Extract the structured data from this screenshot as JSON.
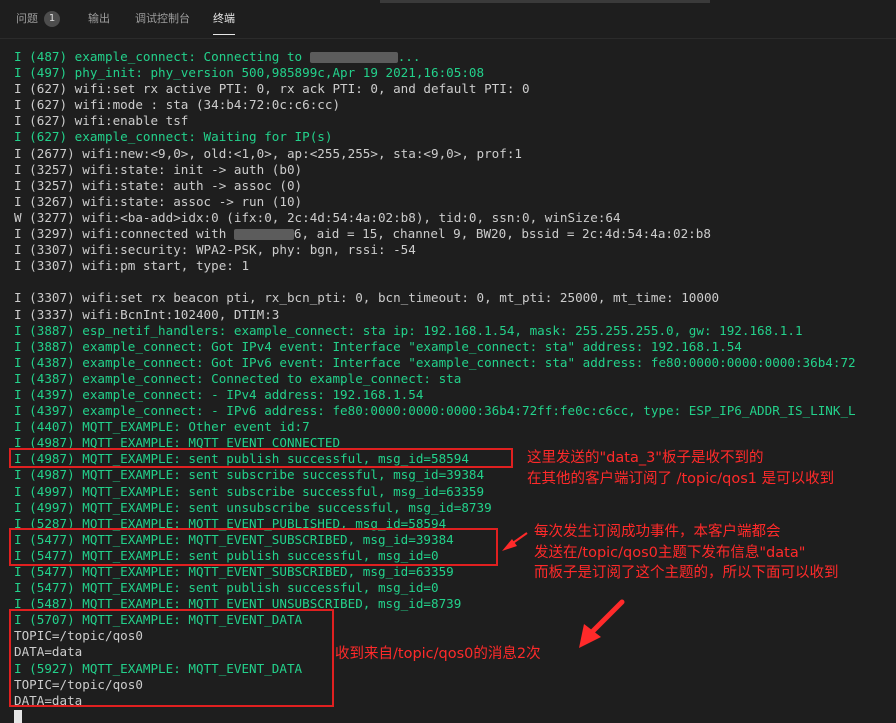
{
  "tabs": [
    {
      "label": "问题",
      "badge": "1"
    },
    {
      "label": "输出"
    },
    {
      "label": "调试控制台"
    },
    {
      "label": "终端",
      "active": true
    }
  ],
  "colors": {
    "info_green": "#23d18b",
    "default_text": "#cccccc",
    "annotation_red": "#ff2a2a",
    "background": "#1e1e1e"
  },
  "terminal": {
    "lines": [
      {
        "text": "I (487) example_connect: Connecting to ",
        "tail": "...",
        "color": "green",
        "redacted": true
      },
      {
        "text": "I (497) phy_init: phy_version 500,985899c,Apr 19 2021,16:05:08",
        "color": "green"
      },
      {
        "text": "I (627) wifi:set rx active PTI: 0, rx ack PTI: 0, and default PTI: 0",
        "color": "default"
      },
      {
        "text": "I (627) wifi:mode : sta (34:b4:72:0c:c6:cc)",
        "color": "default"
      },
      {
        "text": "I (627) wifi:enable tsf",
        "color": "default"
      },
      {
        "text": "I (627) example_connect: Waiting for IP(s)",
        "color": "green"
      },
      {
        "text": "I (2677) wifi:new:<9,0>, old:<1,0>, ap:<255,255>, sta:<9,0>, prof:1",
        "color": "default"
      },
      {
        "text": "I (3257) wifi:state: init -> auth (b0)",
        "color": "default"
      },
      {
        "text": "I (3257) wifi:state: auth -> assoc (0)",
        "color": "default"
      },
      {
        "text": "I (3267) wifi:state: assoc -> run (10)",
        "color": "default"
      },
      {
        "text": "W (3277) wifi:<ba-add>idx:0 (ifx:0, 2c:4d:54:4a:02:b8), tid:0, ssn:0, winSize:64",
        "color": "default"
      },
      {
        "text": "I (3297) wifi:connected with ",
        "tail": "6, aid = 15, channel 9, BW20, bssid = 2c:4d:54:4a:02:b8",
        "color": "default",
        "redacted": true
      },
      {
        "text": "I (3307) wifi:security: WPA2-PSK, phy: bgn, rssi: -54",
        "color": "default"
      },
      {
        "text": "I (3307) wifi:pm start, type: 1",
        "color": "default"
      },
      {
        "text": "",
        "color": "default"
      },
      {
        "text": "I (3307) wifi:set rx beacon pti, rx_bcn_pti: 0, bcn_timeout: 0, mt_pti: 25000, mt_time: 10000",
        "color": "default"
      },
      {
        "text": "I (3337) wifi:BcnInt:102400, DTIM:3",
        "color": "default"
      },
      {
        "text": "I (3887) esp_netif_handlers: example_connect: sta ip: 192.168.1.54, mask: 255.255.255.0, gw: 192.168.1.1",
        "color": "green"
      },
      {
        "text": "I (3887) example_connect: Got IPv4 event: Interface \"example_connect: sta\" address: 192.168.1.54",
        "color": "green"
      },
      {
        "text": "I (4387) example_connect: Got IPv6 event: Interface \"example_connect: sta\" address: fe80:0000:0000:0000:36b4:72",
        "color": "green"
      },
      {
        "text": "I (4387) example_connect: Connected to example_connect: sta",
        "color": "green"
      },
      {
        "text": "I (4397) example_connect: - IPv4 address: 192.168.1.54",
        "color": "green"
      },
      {
        "text": "I (4397) example_connect: - IPv6 address: fe80:0000:0000:0000:36b4:72ff:fe0c:c6cc, type: ESP_IP6_ADDR_IS_LINK_L",
        "color": "green"
      },
      {
        "text": "I (4407) MQTT_EXAMPLE: Other event id:7",
        "color": "green"
      },
      {
        "text": "I (4987) MQTT_EXAMPLE: MQTT_EVENT_CONNECTED",
        "color": "green"
      },
      {
        "text": "I (4987) MQTT_EXAMPLE: sent publish successful, msg_id=58594",
        "color": "green"
      },
      {
        "text": "I (4987) MQTT_EXAMPLE: sent subscribe successful, msg_id=39384",
        "color": "green"
      },
      {
        "text": "I (4997) MQTT_EXAMPLE: sent subscribe successful, msg_id=63359",
        "color": "green"
      },
      {
        "text": "I (4997) MQTT_EXAMPLE: sent unsubscribe successful, msg_id=8739",
        "color": "green"
      },
      {
        "text": "I (5287) MQTT_EXAMPLE: MQTT_EVENT_PUBLISHED, msg_id=58594",
        "color": "green"
      },
      {
        "text": "I (5477) MQTT_EXAMPLE: MQTT_EVENT_SUBSCRIBED, msg_id=39384",
        "color": "green"
      },
      {
        "text": "I (5477) MQTT_EXAMPLE: sent publish successful, msg_id=0",
        "color": "green"
      },
      {
        "text": "I (5477) MQTT_EXAMPLE: MQTT_EVENT_SUBSCRIBED, msg_id=63359",
        "color": "green"
      },
      {
        "text": "I (5477) MQTT_EXAMPLE: sent publish successful, msg_id=0",
        "color": "green"
      },
      {
        "text": "I (5487) MQTT_EXAMPLE: MQTT_EVENT_UNSUBSCRIBED, msg_id=8739",
        "color": "green"
      },
      {
        "text": "I (5707) MQTT_EXAMPLE: MQTT_EVENT_DATA",
        "color": "green"
      },
      {
        "text": "TOPIC=/topic/qos0",
        "color": "default"
      },
      {
        "text": "DATA=data",
        "color": "default"
      },
      {
        "text": "I (5927) MQTT_EXAMPLE: MQTT_EVENT_DATA",
        "color": "green"
      },
      {
        "text": "TOPIC=/topic/qos0",
        "color": "default"
      },
      {
        "text": "DATA=data",
        "color": "default"
      }
    ]
  },
  "annotations": {
    "note1": [
      "这里发送的\"data_3\"板子是收不到的",
      "在其他的客户端订阅了 /topic/qos1 是可以收到"
    ],
    "note2": [
      "每次发生订阅成功事件，本客户端都会",
      "发送在/topic/qos0主题下发布信息\"data\"",
      "而板子是订阅了这个主题的，所以下面可以收到"
    ],
    "note3": [
      "收到来自/topic/qos0的消息2次"
    ]
  }
}
